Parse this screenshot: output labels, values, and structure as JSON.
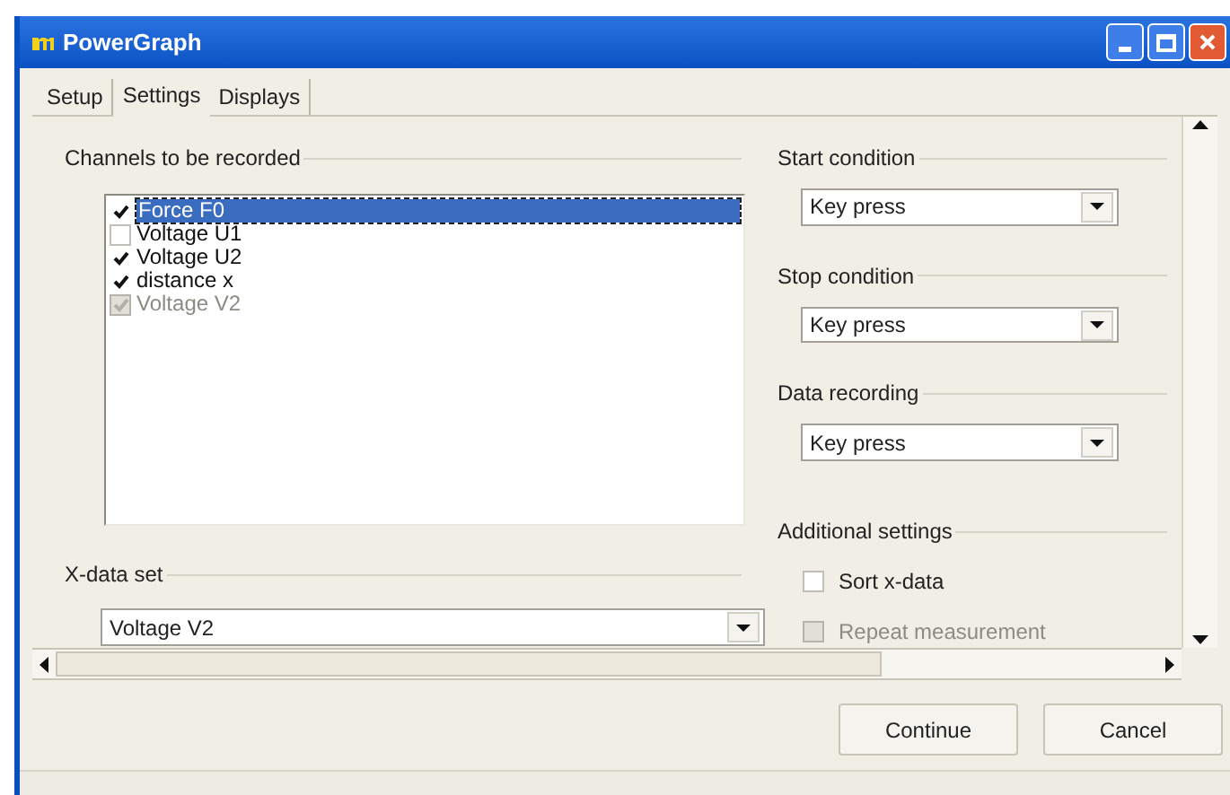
{
  "window": {
    "title": "PowerGraph"
  },
  "tabs": [
    {
      "label": "Setup",
      "selected": false
    },
    {
      "label": "Settings",
      "selected": true
    },
    {
      "label": "Displays",
      "selected": false
    }
  ],
  "channels": {
    "label": "Channels to be recorded",
    "items": [
      {
        "label": "Force F0",
        "checked": true,
        "disabled": false,
        "selected": true
      },
      {
        "label": "Voltage U1",
        "checked": false,
        "disabled": false,
        "selected": false
      },
      {
        "label": "Voltage U2",
        "checked": true,
        "disabled": false,
        "selected": false
      },
      {
        "label": "distance x",
        "checked": true,
        "disabled": false,
        "selected": false
      },
      {
        "label": "Voltage V2",
        "checked": true,
        "disabled": true,
        "selected": false
      }
    ]
  },
  "x_data_set": {
    "label": "X-data set",
    "value": "Voltage V2"
  },
  "conditions": [
    {
      "label": "Start condition",
      "value": "Key press"
    },
    {
      "label": "Stop condition",
      "value": "Key press"
    },
    {
      "label": "Data recording",
      "value": "Key press"
    }
  ],
  "additional_settings": {
    "label": "Additional settings",
    "options": [
      {
        "label": "Sort x-data",
        "checked": false,
        "disabled": false
      },
      {
        "label": "Repeat measurement",
        "checked": false,
        "disabled": true
      }
    ]
  },
  "buttons": [
    "Continue",
    "Cancel"
  ]
}
